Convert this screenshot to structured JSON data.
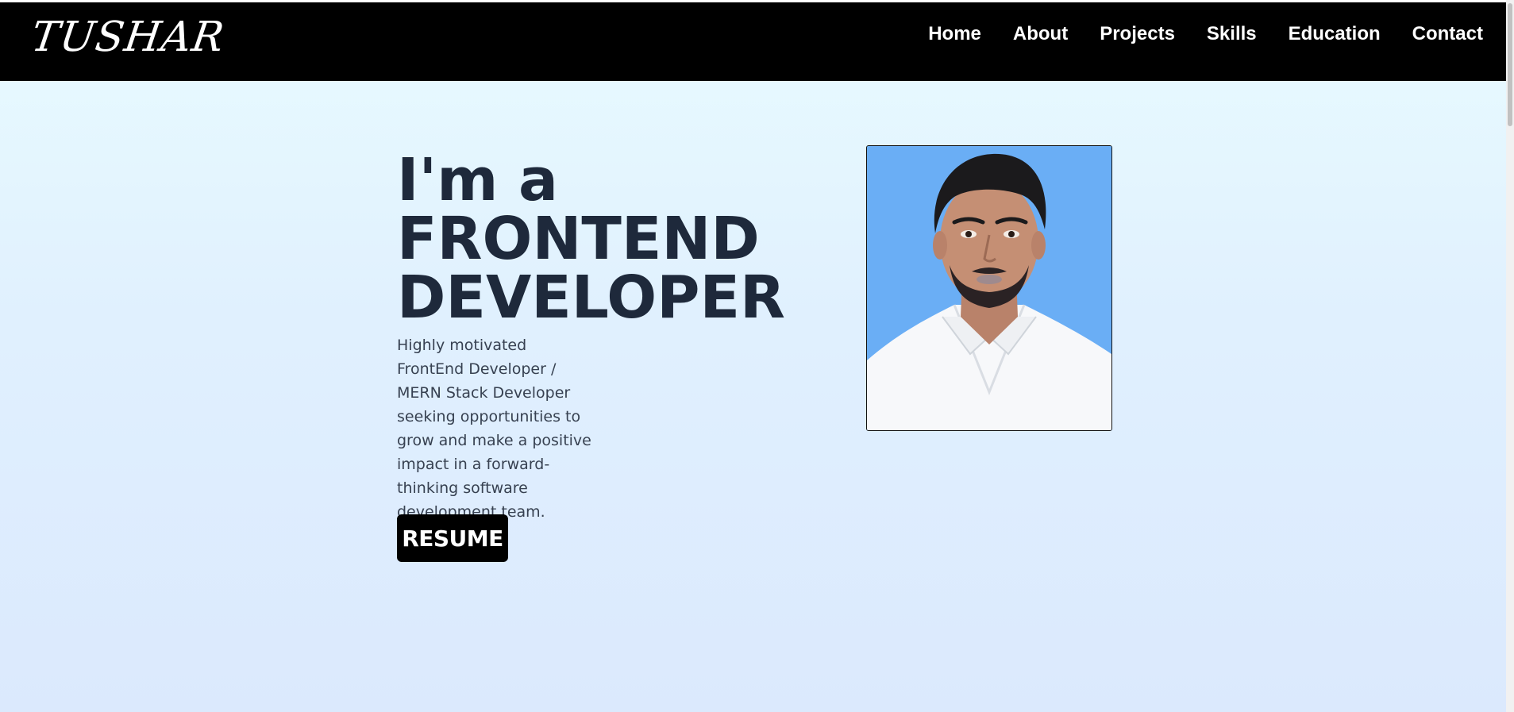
{
  "header": {
    "logo_text": "TUSHAR",
    "nav_items": [
      {
        "label": "Home"
      },
      {
        "label": "About"
      },
      {
        "label": "Projects"
      },
      {
        "label": "Skills"
      },
      {
        "label": "Education"
      },
      {
        "label": "Contact"
      }
    ]
  },
  "hero": {
    "title_line1": "I'm a",
    "title_line2": "FRONTEND",
    "title_line3": "DEVELOPER",
    "description": "Highly motivated FrontEnd Developer / MERN Stack Developer seeking opportunities to grow and make a positive impact in a forward-thinking software development team.",
    "resume_label": "RESUME"
  },
  "colors": {
    "navbar": "#000000",
    "title": "#1e293b",
    "photo_background": "#6aaef5",
    "page_gradient_top": "#e8fbff",
    "page_gradient_bottom": "#dbe9fd"
  }
}
